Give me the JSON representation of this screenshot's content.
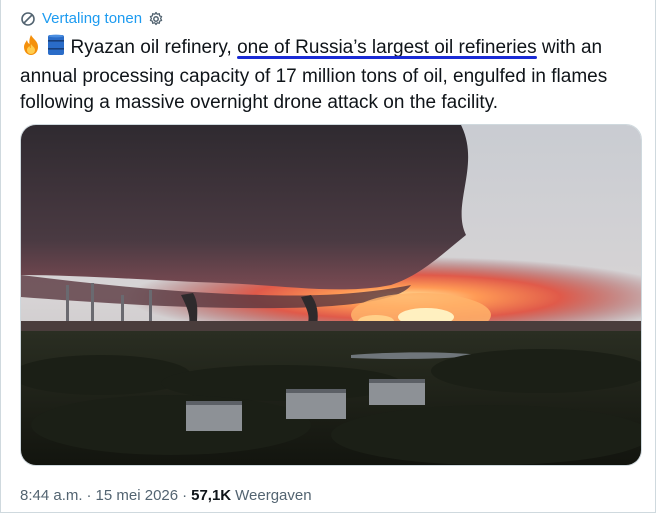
{
  "translate": {
    "label": "Vertaling tonen",
    "icon": "translate-icon",
    "settings_icon": "gear-icon"
  },
  "tweet": {
    "emojis": [
      "fire-emoji",
      "oil-drum-emoji"
    ],
    "text_before": " Ryazan oil refinery, ",
    "highlight": "one of Russia’s largest oil refineries",
    "text_after": " with an annual processing capacity of 17 million tons of oil, engulfed in flames following a massive overnight drone attack on the facility."
  },
  "media": {
    "description_icon": "refinery-fire-photo"
  },
  "meta": {
    "time": "8:44 a.m.",
    "date": "15 mei 2026",
    "separator": "·",
    "views_count": "57,1K",
    "views_label": "Weergaven"
  },
  "colors": {
    "accent": "#1d9bf0",
    "highlight_underline": "#1a2bd6",
    "text": "#0f1419",
    "muted": "#536471"
  }
}
